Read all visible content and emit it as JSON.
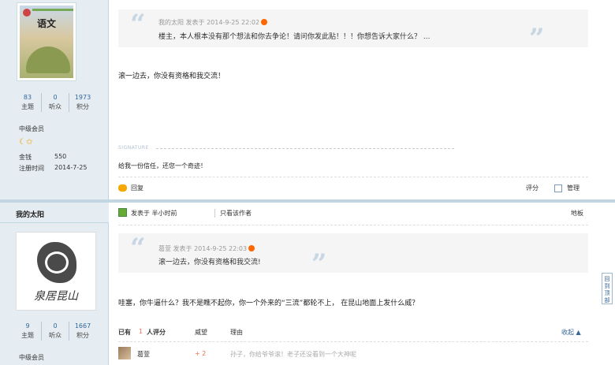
{
  "post1": {
    "sidebar": {
      "stats": [
        {
          "num": "83",
          "label": "主题"
        },
        {
          "num": "0",
          "label": "听众"
        },
        {
          "num": "1973",
          "label": "积分"
        }
      ],
      "group": "中级会员",
      "money_label": "金钱",
      "money_value": "550",
      "reg_label": "注册时间",
      "reg_value": "2014-7-25",
      "avatar_title": "语文"
    },
    "quote": {
      "meta": "我的太阳 发表于 2014-9-25 22:02",
      "text": "楼主，本人根本没有那个想法和你去争论！请问你发此贴！！！你想告诉大家什么？ ..."
    },
    "text": "滚一边去，你没有资格和我交流！",
    "signature_label": "SIGNATURE",
    "signature": "给我一份信任，还您一个奇迹！",
    "reply_label": "回复",
    "rate_label": "评分",
    "manage_label": "管理"
  },
  "post2": {
    "author": "我的太阳",
    "avatar_text": "泉居昆山",
    "sidebar": {
      "stats": [
        {
          "num": "9",
          "label": "主题"
        },
        {
          "num": "0",
          "label": "听众"
        },
        {
          "num": "1667",
          "label": "积分"
        }
      ],
      "group": "中级会员"
    },
    "posted_prefix": "发表于",
    "posted_time": "半小时前",
    "only_author": "只看该作者",
    "floor": "地板",
    "quote": {
      "meta": "葛萱 发表于 2014-9-25 22:03",
      "text": "滚一边去，你没有资格和我交流!"
    },
    "text": "哇塞，你牛逼什么？我不是瞧不起你，你一个外来的“三流”都轮不上，  在昆山地面上发什么威？",
    "rating": {
      "prefix": "已有",
      "count": "1",
      "suffix": "人评分",
      "col_weiwang": "威望",
      "col_reason": "理由",
      "collapse": "收起 ▲",
      "rows": [
        {
          "user": "葛萱",
          "score": "+ 2",
          "reason": "孙子，你给爷爷滚！老子还没看到一个大神呢"
        }
      ]
    }
  },
  "back_to_top": "回到顶部"
}
